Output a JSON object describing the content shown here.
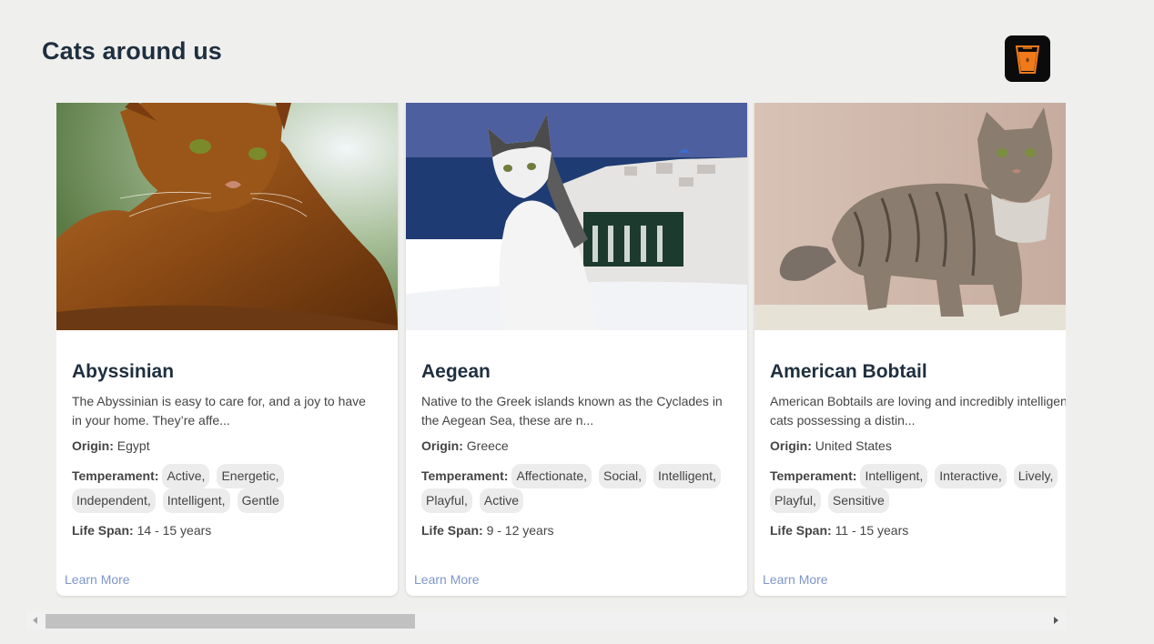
{
  "page": {
    "title": "Cats around us"
  },
  "logo": {
    "icon": "drink-cup-icon"
  },
  "cards": [
    {
      "name": "Abyssinian",
      "description": "The Abyssinian is easy to care for, and a joy to have in your home. They’re affe...",
      "origin_label": "Origin:",
      "origin": "Egypt",
      "temperament_label": "Temperament:",
      "temperament": [
        "Active,",
        "Energetic,",
        "Independent,",
        "Intelligent,",
        "Gentle"
      ],
      "life_span_label": "Life Span:",
      "life_span": "14 - 15 years",
      "learn_more": "Learn More"
    },
    {
      "name": "Aegean",
      "description": "Native to the Greek islands known as the Cyclades in the Aegean Sea, these are n...",
      "origin_label": "Origin:",
      "origin": "Greece",
      "temperament_label": "Temperament:",
      "temperament": [
        "Affectionate,",
        "Social,",
        "Intelligent,",
        "Playful,",
        "Active"
      ],
      "life_span_label": "Life Span:",
      "life_span": "9 - 12 years",
      "learn_more": "Learn More"
    },
    {
      "name": "American Bobtail",
      "description": "American Bobtails are loving and incredibly intelligent cats possessing a distin...",
      "origin_label": "Origin:",
      "origin": "United States",
      "temperament_label": "Temperament:",
      "temperament": [
        "Intelligent,",
        "Interactive,",
        "Lively,",
        "Playful,",
        "Sensitive"
      ],
      "life_span_label": "Life Span:",
      "life_span": "11 - 15 years",
      "learn_more": "Learn More"
    }
  ],
  "scrollbar": {
    "position": 0.0
  }
}
